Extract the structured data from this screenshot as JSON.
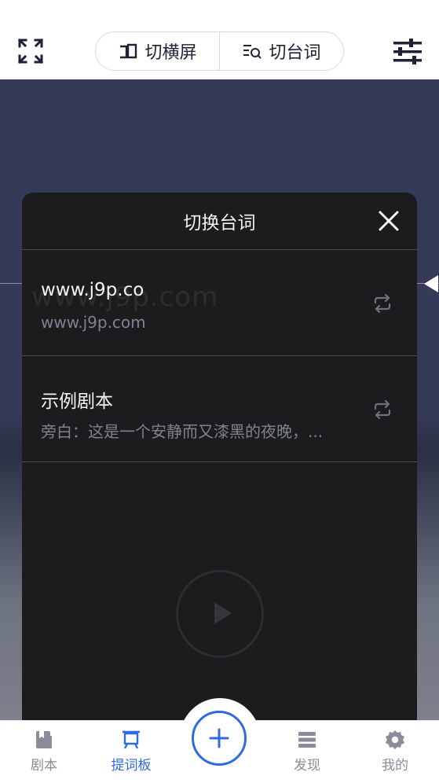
{
  "header": {
    "toggle_landscape_label": "切横屏",
    "switch_script_label": "切台词"
  },
  "panel": {
    "title": "切换台词",
    "items": [
      {
        "title": "www.j9p.co",
        "subtitle": "www.j9p.com"
      },
      {
        "title": "示例剧本",
        "subtitle": "旁白：这是一个安静而又漆黑的夜晚，..."
      }
    ],
    "watermark": "www.j9p.com"
  },
  "bottom_nav": {
    "items": [
      {
        "label": "剧本",
        "icon": "script-icon"
      },
      {
        "label": "提词板",
        "icon": "prompter-icon",
        "active": true
      },
      {
        "label": "发现",
        "icon": "discover-icon"
      },
      {
        "label": "我的",
        "icon": "profile-gear-icon"
      }
    ],
    "fab_icon": "plus-icon"
  },
  "colors": {
    "accent": "#2f6bde",
    "panel_bg": "#1c1c1e",
    "stage_bg": "#353a58"
  }
}
